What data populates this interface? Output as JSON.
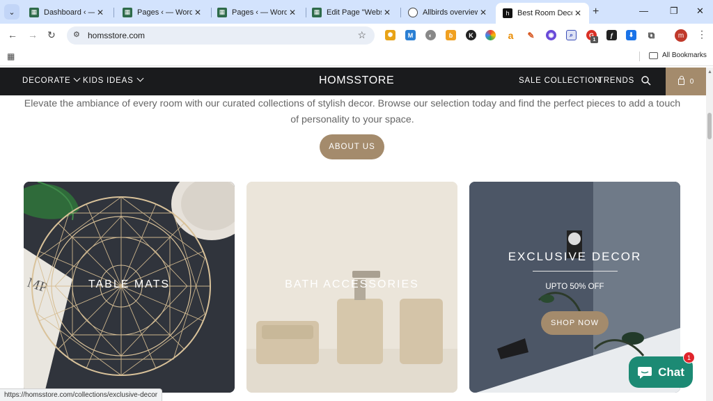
{
  "browser": {
    "tabs": [
      {
        "title": "Dashboard ‹ — W",
        "favicon_color": "#2e6b4a",
        "active": false
      },
      {
        "title": "Pages ‹ — WordPr",
        "favicon_color": "#2e6b4a",
        "active": false
      },
      {
        "title": "Pages ‹ — WordPr",
        "favicon_color": "#2e6b4a",
        "active": false
      },
      {
        "title": "Edit Page \"Website",
        "favicon_color": "#2e6b4a",
        "active": false
      },
      {
        "title": "Allbirds overview a",
        "favicon_color": "#444444",
        "active": false
      },
      {
        "title": "Best Room Decor a",
        "favicon_glyph": "h",
        "favicon_color": "#111111",
        "active": true
      }
    ],
    "address": "homsstore.com",
    "bookmarks_label": "All Bookmarks",
    "profile_initial": "m",
    "extensions_badge": "1",
    "status_url": "https://homsstore.com/collections/exclusive-decor"
  },
  "site": {
    "logo": "HOMSSTORE",
    "nav_left": [
      "DECORATE",
      "KIDS IDEAS"
    ],
    "nav_right": [
      "SALE COLLECTION",
      "TRENDS"
    ],
    "cart_count": "0",
    "intro_text": "Elevate the ambiance of every room with our curated collections of stylish decor. Browse our selection today and find the perfect pieces to add a touch of personality to your space.",
    "about_button": "ABOUT US",
    "cards": [
      {
        "label": "TABLE MATS"
      },
      {
        "label": "BATH ACCESSORIES"
      },
      {
        "label": "EXCLUSIVE DECOR",
        "subtitle": "UPTO 50% OFF",
        "button": "SHOP NOW"
      }
    ],
    "chat": {
      "label": "Chat",
      "badge": "1"
    }
  },
  "colors": {
    "accent": "#a48b6c",
    "header_bg": "#1a1b1d",
    "chat_green": "#1c8a74"
  }
}
